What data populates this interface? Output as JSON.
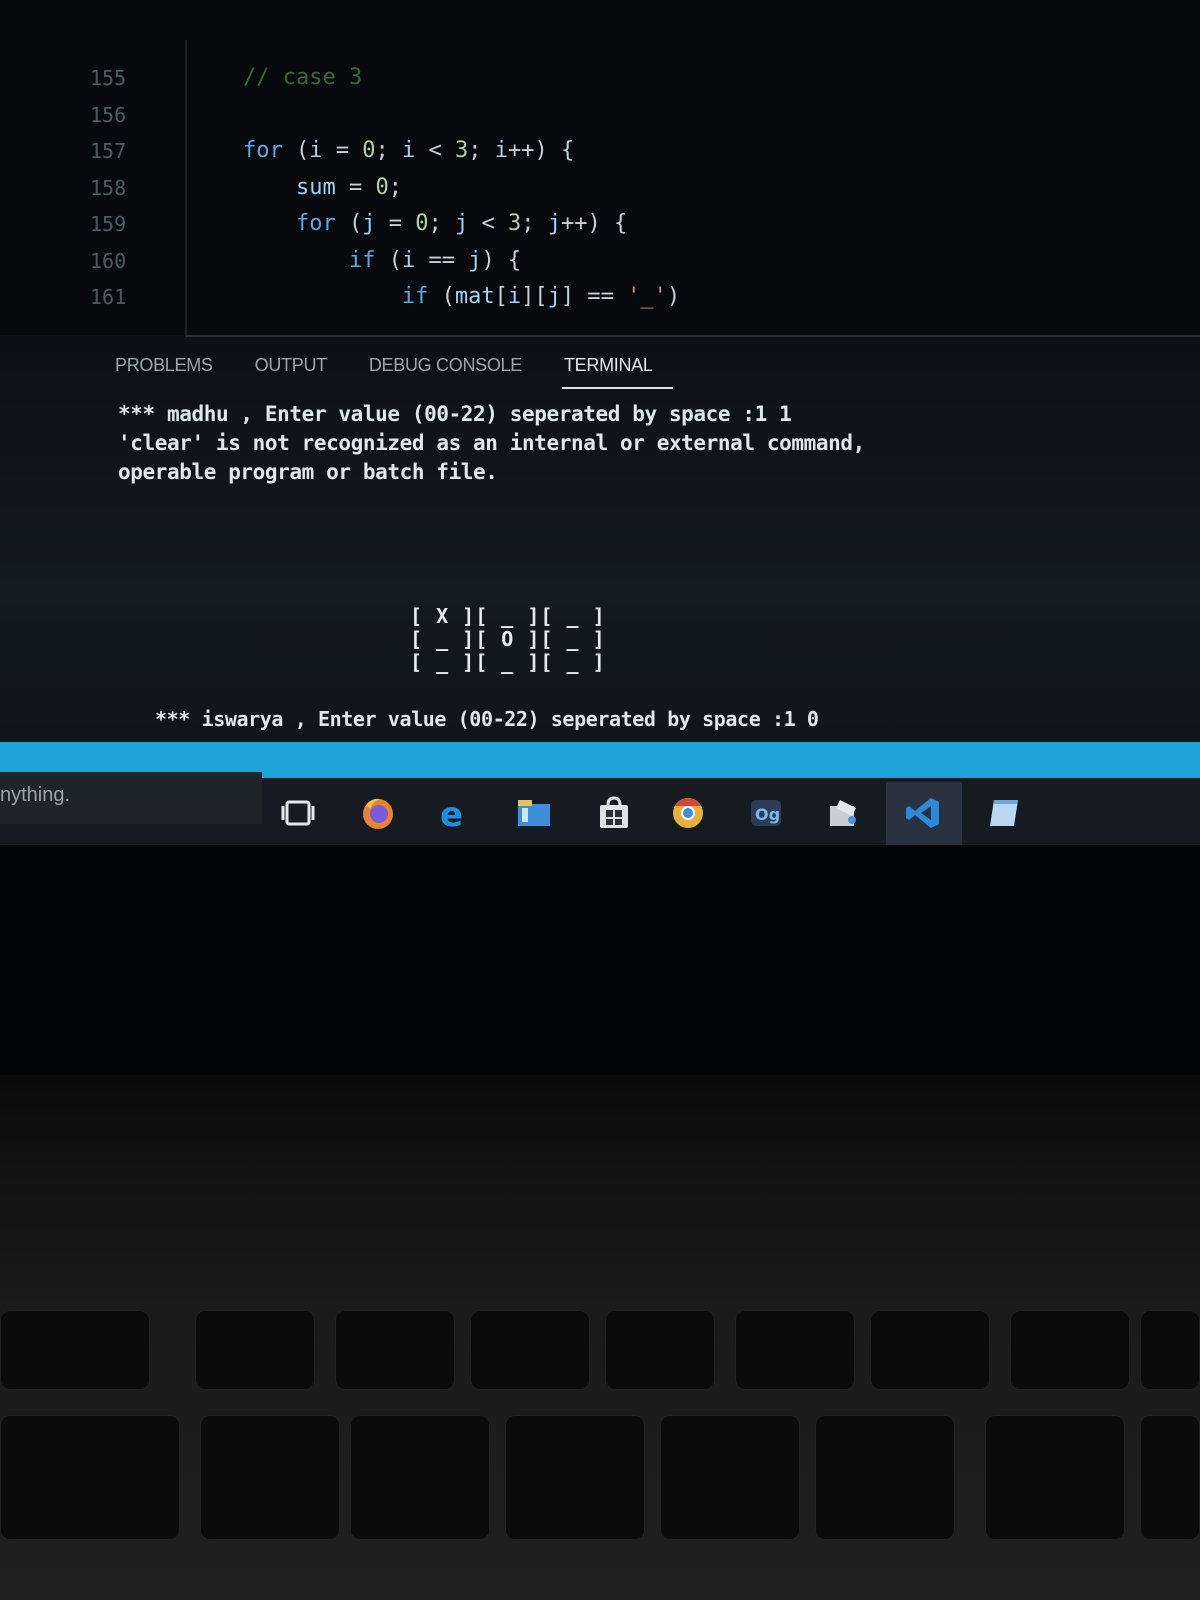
{
  "editor": {
    "line_numbers": [
      "155",
      "156",
      "157",
      "158",
      "159",
      "160",
      "161"
    ],
    "code_lines": [
      {
        "indent": "    ",
        "comment": "// case 3"
      },
      {
        "indent": "",
        "text": ""
      },
      {
        "indent": "    ",
        "text": "for (i = 0; i < 3; i++) {"
      },
      {
        "indent": "        ",
        "text": "sum = 0;"
      },
      {
        "indent": "        ",
        "text": "for (j = 0; j < 3; j++) {"
      },
      {
        "indent": "            ",
        "text": "if (i == j) {"
      },
      {
        "indent": "                ",
        "text": "if (mat[i][j] == '_')"
      }
    ]
  },
  "panel": {
    "tabs": [
      "PROBLEMS",
      "OUTPUT",
      "DEBUG CONSOLE",
      "TERMINAL"
    ],
    "active_tab": "TERMINAL"
  },
  "terminal": {
    "lines": [
      "*** madhu , Enter value (00-22) seperated by space :1 1",
      "'clear' is not recognized as an internal or external command,",
      "operable program or batch file."
    ],
    "board": [
      "[ X ][ _ ][ _ ]",
      "[ _ ][ O ][ _ ]",
      "[ _ ][ _ ][ _ ]"
    ],
    "prompt": "*** iswarya , Enter value (00-22) seperated by space :1 0"
  },
  "taskbar": {
    "search_placeholder": "nything.",
    "icons": [
      "task-view-icon",
      "firefox-icon",
      "edge-icon",
      "file-explorer-icon",
      "store-icon",
      "chrome-icon",
      "app-icon",
      "paint-icon",
      "vscode-icon",
      "notepad-icon"
    ]
  },
  "colors": {
    "status_bar": "#1ea3d8",
    "keyword": "#5aa7e6",
    "comment": "#2f6b3a",
    "terminal_text": "#dfe7ef"
  }
}
